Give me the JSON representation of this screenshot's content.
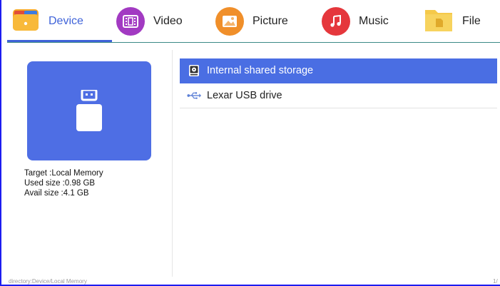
{
  "tabs": [
    {
      "label": "Device",
      "icon": "folder-icon",
      "active": true
    },
    {
      "label": "Video",
      "icon": "film-icon",
      "active": false
    },
    {
      "label": "Picture",
      "icon": "image-icon",
      "active": false
    },
    {
      "label": "Music",
      "icon": "music-note-icon",
      "active": false
    },
    {
      "label": "File",
      "icon": "file-icon",
      "active": false
    }
  ],
  "device": {
    "target": "Target :Local Memory",
    "used": "Used size :0.98 GB",
    "avail": "Avail size :4.1 GB"
  },
  "storage_list": [
    {
      "label": "Internal shared storage",
      "icon": "internal-storage-icon",
      "selected": true
    },
    {
      "label": "Lexar USB drive",
      "icon": "usb-icon",
      "selected": false
    }
  ],
  "status": {
    "path": "directory:Device/Local Memory",
    "page": "1/"
  },
  "colors": {
    "accent": "#3f63d9",
    "selected_row": "#4a6ee3",
    "video": "#a23ac2",
    "picture": "#f08f2a",
    "music": "#e5373c",
    "file": "#f5c94a"
  }
}
